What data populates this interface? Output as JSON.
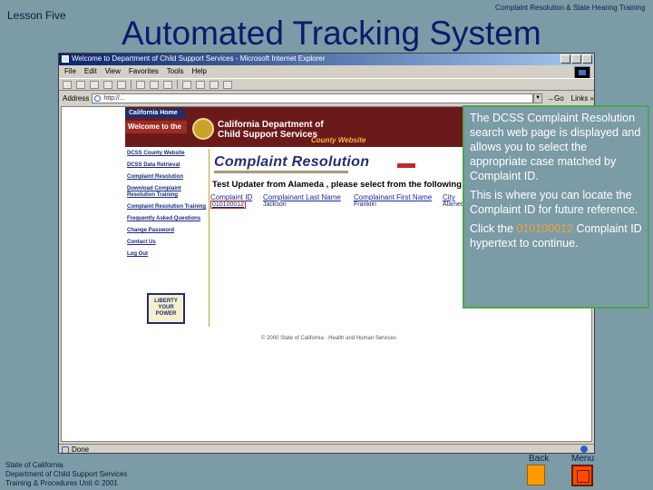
{
  "slide": {
    "lesson": "Lesson Five",
    "course": "Complaint Resolution & State Hearing Training",
    "title": "Automated Tracking System",
    "footer_lines": [
      "State of California",
      "Department of Child Support Services",
      "Training & Procedures Unit  © 2001"
    ],
    "nav": {
      "back_label": "Back",
      "menu_label": "Menu"
    }
  },
  "browser": {
    "title": "Welcome to Department of Child Support Services - Microsoft Internet Explorer",
    "menu": [
      "File",
      "Edit",
      "View",
      "Favorites",
      "Tools",
      "Help"
    ],
    "address_label": "Address",
    "address_value": "http://...",
    "go_label": "Go",
    "links_label": "Links »",
    "status_text": "Done",
    "zone_text": ""
  },
  "site": {
    "home_link": "California Home",
    "welcome": "Welcome to the",
    "dept_line1": "California Department of",
    "dept_line2": "Child Support Services",
    "county_label": "County Website",
    "nav_links": [
      "DCSS County Website",
      "DCSS Data Retrieval",
      "Complaint Resolution",
      "Download Complaint Resolution Training",
      "Complaint Resolution Training",
      "Frequently Asked Questions",
      "Change Password",
      "Contact Us",
      "Log Out"
    ],
    "liberty_logo_text": "LIBERTY YOUR POWER",
    "app_logo": "Complaint Resolution",
    "heading": "Test Updater from Alameda , please select from the following Com",
    "table": {
      "columns": [
        "Complaint ID",
        "Complainant Last Name",
        "Complainant First Name",
        "City"
      ],
      "rows": [
        [
          "010100012",
          "Jackson",
          "Franklin",
          "Alamed"
        ]
      ]
    },
    "copyright": "© 2000 State of California - Health and Human Services"
  },
  "callout": {
    "para1": "The DCSS Complaint Resolution search web page is displayed and allows you to select the appropriate case matched by Complaint ID.",
    "para2": "This is where you can locate the Complaint ID for future reference.",
    "para3_before": "Click the ",
    "para3_id": "010100012",
    "para3_after": " Complaint ID hypertext  to continue."
  },
  "colors": {
    "slide_background": "#7B9BA6",
    "title_text": "#0a1a6e",
    "callout_border": "#4ca64c",
    "highlight": "#f0a23a",
    "banner": "#6b1a1a",
    "back_button": "#ff9b00",
    "menu_button": "#ff4b00"
  },
  "icons": {
    "browser_throbber": "windows-logo-icon",
    "address_icon": "page-icon",
    "status_icon": "page-icon",
    "zone_icon": "internet-zone-icon"
  }
}
